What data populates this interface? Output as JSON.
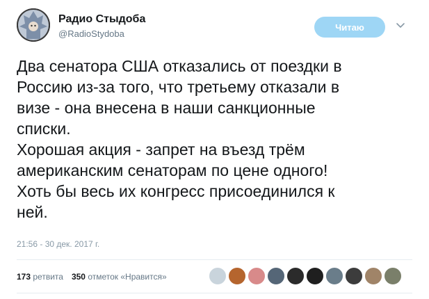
{
  "user": {
    "name": "Радио Стыдоба",
    "handle": "@RadioStydoba"
  },
  "follow_button": {
    "label": "Читаю"
  },
  "tweet": {
    "lines": [
      "Два сенатора США отказались от поездки в",
      "Россию из-за того, что третьему отказали в",
      "визе - она внесена в наши санкционные",
      "списки.",
      "Хорошая акция - запрет на въезд трём",
      "американским сенаторам по цене одного!",
      "Хоть бы весь их конгресс присоединился к",
      "ней."
    ],
    "timestamp": "21:56 - 30 дек. 2017 г."
  },
  "stats": {
    "retweets_count": "173",
    "retweets_label": "ретвита",
    "likes_count": "350",
    "likes_label": "отметок «Нравится»"
  },
  "likers": [
    {
      "color": "#c9d4dc"
    },
    {
      "color": "#b5652e"
    },
    {
      "color": "#d88a8a"
    },
    {
      "color": "#556677"
    },
    {
      "color": "#2b2b2b"
    },
    {
      "color": "#1f1f1f"
    },
    {
      "color": "#6a7d8a"
    },
    {
      "color": "#3c3c3c"
    },
    {
      "color": "#a08468"
    },
    {
      "color": "#7a7f6a"
    }
  ]
}
